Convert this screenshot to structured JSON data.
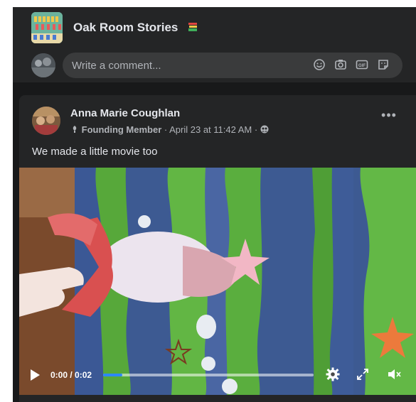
{
  "group": {
    "title": "Oak Room Stories",
    "title_icon": "books-icon"
  },
  "comment_bar": {
    "placeholder": "Write a comment...",
    "icons": [
      "emoji-icon",
      "camera-icon",
      "gif-icon",
      "sticker-icon"
    ]
  },
  "post": {
    "author": "Anna Marie Coughlan",
    "badge": "Founding Member",
    "meta_rest": " · April 23 at 11:42 AM · ",
    "audience_icon": "group-audience-icon",
    "text": "We made a little movie too",
    "more_label": "•••"
  },
  "video": {
    "time_label": "0:00 / 0:02",
    "progress": 0.09
  },
  "colors": {
    "background": "#18191a",
    "card": "#242526",
    "input": "#3a3b3c",
    "accent": "#2d88ff"
  }
}
